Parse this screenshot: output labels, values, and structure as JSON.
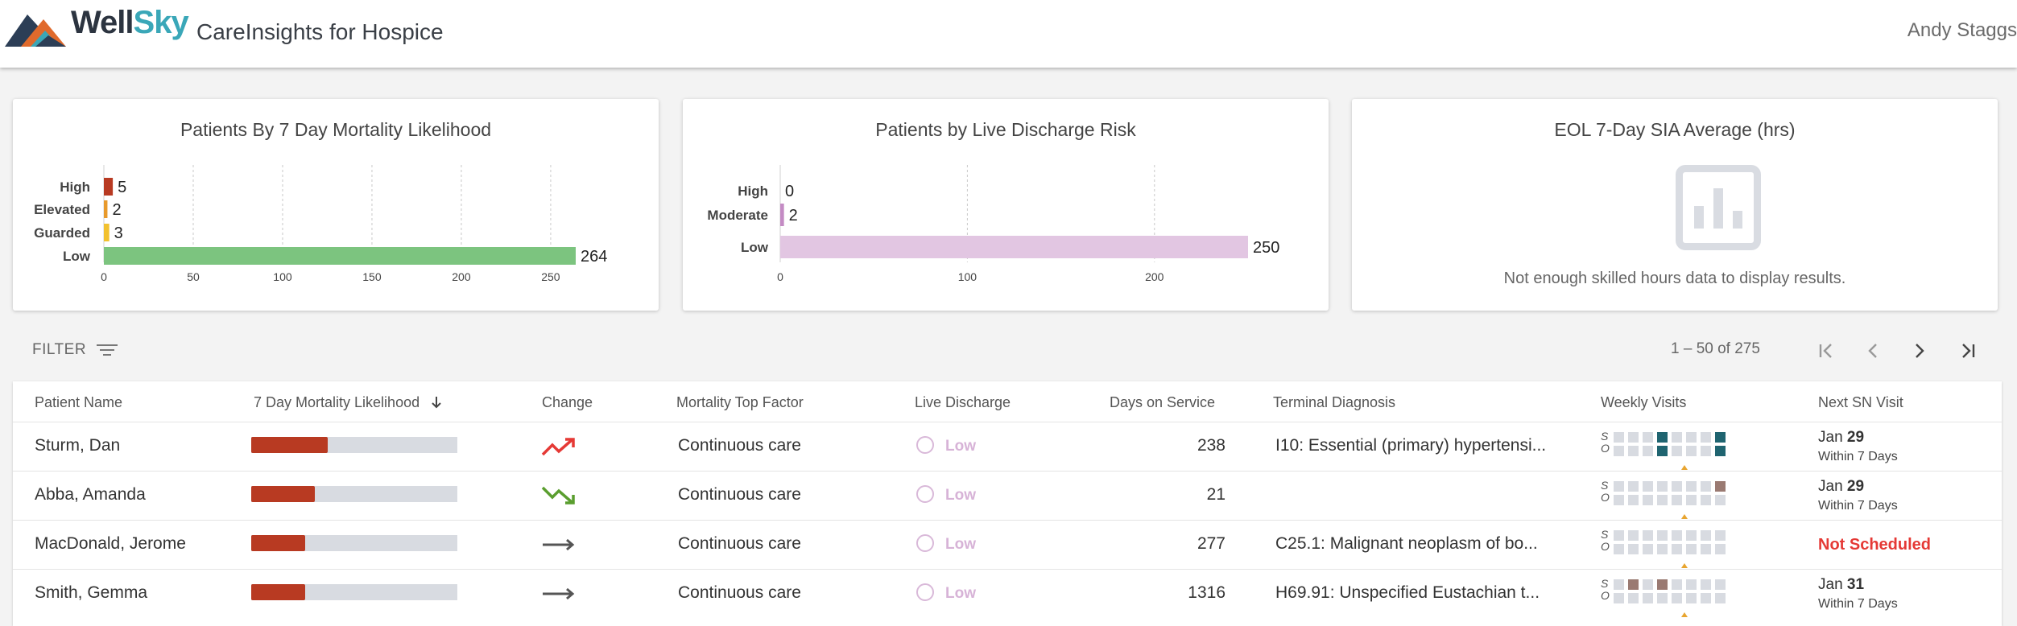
{
  "header": {
    "logo_part1": "Well",
    "logo_part2": "Sky",
    "app_title": "CareInsights for Hospice",
    "user_name": "Andy Staggs"
  },
  "cards": {
    "mortality_title": "Patients By 7 Day Mortality Likelihood",
    "discharge_title": "Patients by Live Discharge Risk",
    "eol_title": "EOL 7-Day SIA Average (hrs)",
    "eol_empty_message": "Not enough skilled hours data to display results."
  },
  "chart_data": [
    {
      "type": "bar",
      "orientation": "horizontal",
      "title": "Patients By 7 Day Mortality Likelihood",
      "categories": [
        "High",
        "Elevated",
        "Guarded",
        "Low"
      ],
      "values": [
        5,
        2,
        3,
        264
      ],
      "colors": [
        "#b83a22",
        "#e89a2c",
        "#f2c12e",
        "#7cc47f"
      ],
      "xlim": [
        0,
        264
      ],
      "ticks": [
        0,
        50,
        100,
        150,
        200,
        250
      ],
      "grid": true
    },
    {
      "type": "bar",
      "orientation": "horizontal",
      "title": "Patients by Live Discharge Risk",
      "categories": [
        "High",
        "Moderate",
        "Low"
      ],
      "values": [
        0,
        2,
        250
      ],
      "colors": [
        "#c48bc4",
        "#c48bc4",
        "#e2c6e2"
      ],
      "xlim": [
        0,
        250
      ],
      "ticks": [
        0,
        100,
        200
      ],
      "grid": true
    }
  ],
  "toolbar": {
    "filter_label": "FILTER",
    "page_range": "1 – 50 of 275"
  },
  "table": {
    "headers": {
      "name": "Patient Name",
      "mortality": "7 Day Mortality Likelihood",
      "change": "Change",
      "top_factor": "Mortality Top Factor",
      "live_discharge": "Live Discharge",
      "days": "Days on Service",
      "diagnosis": "Terminal Diagnosis",
      "weekly": "Weekly Visits",
      "next_sn": "Next SN Visit"
    },
    "visit_row_labels": [
      "S",
      "O"
    ],
    "rows": [
      {
        "name": "Sturm, Dan",
        "mortality_fraction": 0.37,
        "change": "up",
        "top_factor": "Continuous care",
        "live_discharge": "Low",
        "days": "238",
        "diagnosis": "I10: Essential (primary) hypertensi...",
        "visits_s": [
          "",
          "",
          "",
          "teal",
          "",
          "",
          "",
          "teal"
        ],
        "visits_o": [
          "",
          "",
          "",
          "teal",
          "",
          "",
          "",
          "teal"
        ],
        "next_month": "Jan",
        "next_day": "29",
        "next_sub": "Within 7 Days"
      },
      {
        "name": "Abba, Amanda",
        "mortality_fraction": 0.31,
        "change": "down",
        "top_factor": "Continuous care",
        "live_discharge": "Low",
        "days": "21",
        "diagnosis": "",
        "visits_s": [
          "",
          "",
          "",
          "",
          "",
          "",
          "",
          "brown"
        ],
        "visits_o": [
          "",
          "",
          "",
          "",
          "",
          "",
          "",
          ""
        ],
        "next_month": "Jan",
        "next_day": "29",
        "next_sub": "Within 7 Days"
      },
      {
        "name": "MacDonald, Jerome",
        "mortality_fraction": 0.26,
        "change": "flat",
        "top_factor": "Continuous care",
        "live_discharge": "Low",
        "days": "277",
        "diagnosis": "C25.1: Malignant neoplasm of bo...",
        "visits_s": [
          "",
          "",
          "",
          "",
          "",
          "",
          "",
          ""
        ],
        "visits_o": [
          "",
          "",
          "",
          "",
          "",
          "",
          "",
          ""
        ],
        "next_not_scheduled": "Not Scheduled"
      },
      {
        "name": "Smith, Gemma",
        "mortality_fraction": 0.26,
        "change": "flat",
        "top_factor": "Continuous care",
        "live_discharge": "Low",
        "days": "1316",
        "diagnosis": "H69.91: Unspecified Eustachian t...",
        "visits_s": [
          "",
          "brown",
          "",
          "brown",
          "",
          "",
          "",
          ""
        ],
        "visits_o": [
          "",
          "",
          "",
          "",
          "",
          "",
          "",
          ""
        ],
        "next_month": "Jan",
        "next_day": "31",
        "next_sub": "Within 7 Days"
      }
    ]
  },
  "colors": {
    "mortality_bar": "#b83a22",
    "visit_teal": "#1f6470",
    "visit_brown": "#9a7a72",
    "visit_empty": "#d8dbe1",
    "not_scheduled": "#e53935",
    "trend_up": "#e53935",
    "trend_down": "#5a9e2f",
    "trend_flat": "#555555"
  }
}
